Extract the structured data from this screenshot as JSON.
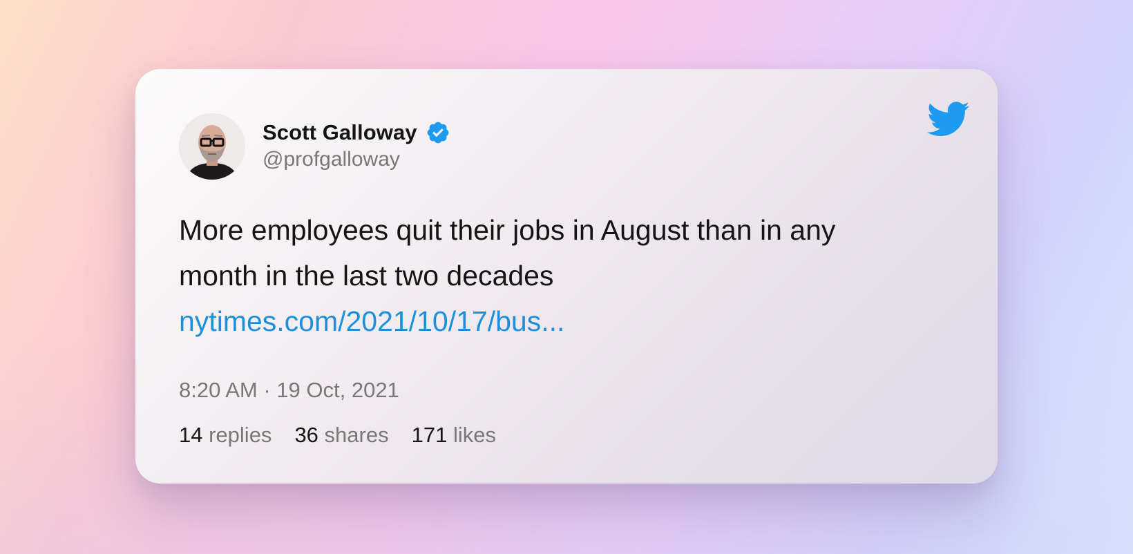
{
  "tweet": {
    "author": {
      "name": "Scott Galloway",
      "handle": "@profgalloway",
      "verified": true
    },
    "text_lines": [
      "More employees quit their jobs in August than in any",
      "month in the last two decades"
    ],
    "link": "nytimes.com/2021/10/17/bus...",
    "timestamp": "8:20 AM · 19 Oct, 2021",
    "stats": {
      "replies": {
        "count": "14",
        "label": "replies"
      },
      "shares": {
        "count": "36",
        "label": "shares"
      },
      "likes": {
        "count": "171",
        "label": "likes"
      }
    }
  },
  "icons": {
    "brand": "twitter-bird-icon",
    "verified": "verified-badge-icon"
  },
  "colors": {
    "link": "#1d8fdb",
    "verified_badge": "#1d9bf0",
    "twitter_brand": "#1d9bf0",
    "text_primary": "#151314",
    "text_secondary": "#7a7677"
  }
}
